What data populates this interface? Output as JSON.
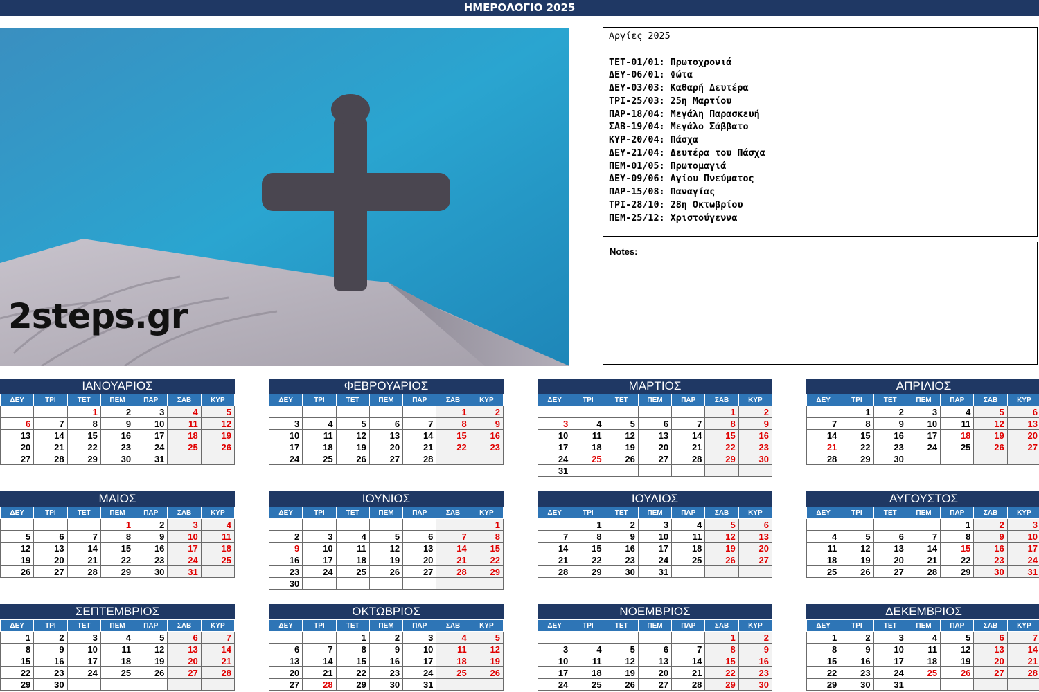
{
  "header": {
    "title": "ΗΜΕΡΟΛΟΓΙΟ 2025"
  },
  "logo_text": "2steps.gr",
  "holidays": {
    "title": "Αργίες 2025",
    "items": [
      "ΤΕΤ-01/01: Πρωτοχρονιά",
      "ΔΕΥ-06/01: Φώτα",
      "ΔΕΥ-03/03: Καθαρή Δευτέρα",
      "ΤΡΙ-25/03: 25η Μαρτίου",
      "ΠΑΡ-18/04: Μεγάλη Παρασκευή",
      "ΣΑΒ-19/04: Μεγάλο Σάββατο",
      "ΚΥΡ-20/04: Πάσχα",
      "ΔΕΥ-21/04: Δευτέρα του Πάσχα",
      "ΠΕΜ-01/05: Πρωτομαγιά",
      "ΔΕΥ-09/06: Αγίου Πνεύματος",
      "ΠΑΡ-15/08: Παναγίας",
      "ΤΡΙ-28/10: 28η Οκτωβρίου",
      "ΠΕΜ-25/12: Χριστούγεννα"
    ]
  },
  "notes": {
    "label": "Notes:"
  },
  "weekdays": [
    "ΔΕΥ",
    "ΤΡΙ",
    "ΤΕΤ",
    "ΠΕΜ",
    "ΠΑΡ",
    "ΣΑΒ",
    "ΚΥΡ"
  ],
  "colors": {
    "header_dark": "#1f3864",
    "weekday_blue": "#2e75b6",
    "holiday_red": "#e00000"
  },
  "months": [
    {
      "name": "ΙΑΝΟΥΑΡΙΟΣ",
      "first_weekday": 3,
      "days": 31,
      "red_days": [
        1,
        6
      ]
    },
    {
      "name": "ΦΕΒΡΟΥΑΡΙΟΣ",
      "first_weekday": 6,
      "days": 28,
      "red_days": []
    },
    {
      "name": "ΜΑΡΤΙΟΣ",
      "first_weekday": 6,
      "days": 31,
      "red_days": [
        3,
        25
      ]
    },
    {
      "name": "ΑΠΡΙΛΙΟΣ",
      "first_weekday": 2,
      "days": 30,
      "red_days": [
        18,
        21
      ]
    },
    {
      "name": "ΜΑΙΟΣ",
      "first_weekday": 4,
      "days": 31,
      "red_days": [
        1
      ]
    },
    {
      "name": "ΙΟΥΝΙΟΣ",
      "first_weekday": 7,
      "days": 30,
      "red_days": [
        9
      ]
    },
    {
      "name": "ΙΟΥΛΙΟΣ",
      "first_weekday": 2,
      "days": 31,
      "red_days": []
    },
    {
      "name": "ΑΥΓΟΥΣΤΟΣ",
      "first_weekday": 5,
      "days": 31,
      "red_days": [
        15
      ]
    },
    {
      "name": "ΣΕΠΤΕΜΒΡΙΟΣ",
      "first_weekday": 1,
      "days": 30,
      "red_days": []
    },
    {
      "name": "ΟΚΤΩΒΡΙΟΣ",
      "first_weekday": 3,
      "days": 31,
      "red_days": [
        28
      ]
    },
    {
      "name": "ΝΟΕΜΒΡΙΟΣ",
      "first_weekday": 6,
      "days": 30,
      "red_days": []
    },
    {
      "name": "ΔΕΚΕΜΒΡΙΟΣ",
      "first_weekday": 1,
      "days": 31,
      "red_days": [
        25,
        26
      ]
    }
  ]
}
